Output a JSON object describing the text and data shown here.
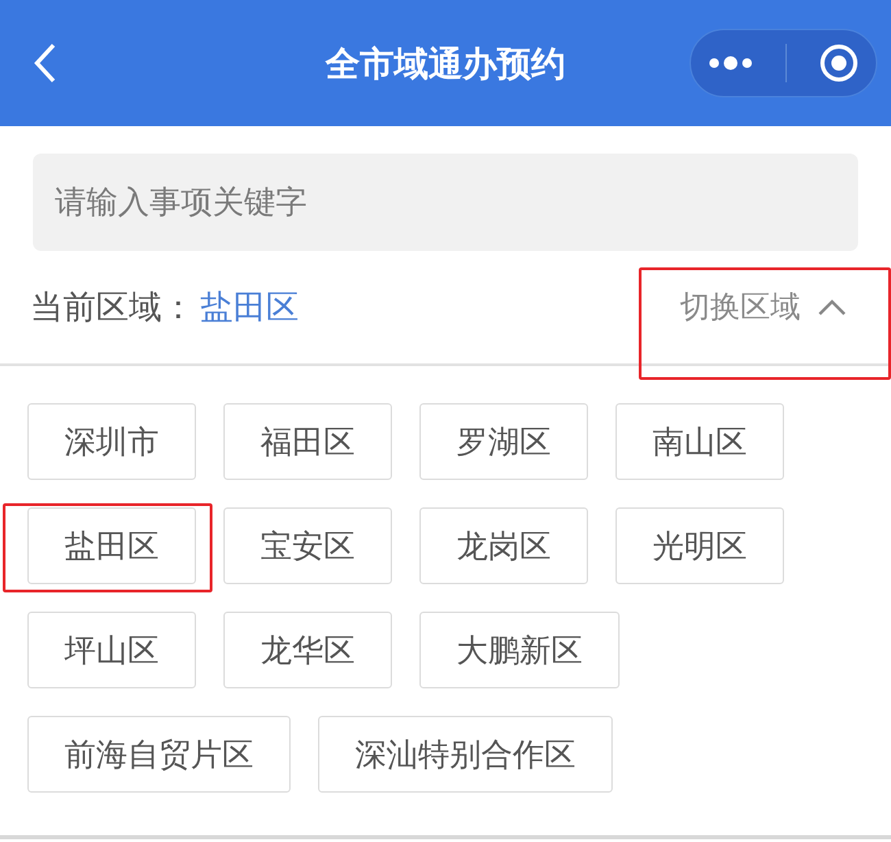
{
  "header": {
    "title": "全市域通办预约"
  },
  "search": {
    "placeholder": "请输入事项关键字"
  },
  "region": {
    "label": "当前区域：",
    "current": "盐田区",
    "switch": "切换区域",
    "expanded": true,
    "highlighted": true
  },
  "districts": [
    {
      "name": "深圳市",
      "highlighted": false
    },
    {
      "name": "福田区",
      "highlighted": false
    },
    {
      "name": "罗湖区",
      "highlighted": false
    },
    {
      "name": "南山区",
      "highlighted": false
    },
    {
      "name": "盐田区",
      "highlighted": true
    },
    {
      "name": "宝安区",
      "highlighted": false
    },
    {
      "name": "龙岗区",
      "highlighted": false
    },
    {
      "name": "光明区",
      "highlighted": false
    },
    {
      "name": "坪山区",
      "highlighted": false
    },
    {
      "name": "龙华区",
      "highlighted": false
    },
    {
      "name": "大鹏新区",
      "highlighted": false
    },
    {
      "name": "前海自贸片区",
      "highlighted": false
    },
    {
      "name": "深汕特别合作区",
      "highlighted": false
    }
  ]
}
